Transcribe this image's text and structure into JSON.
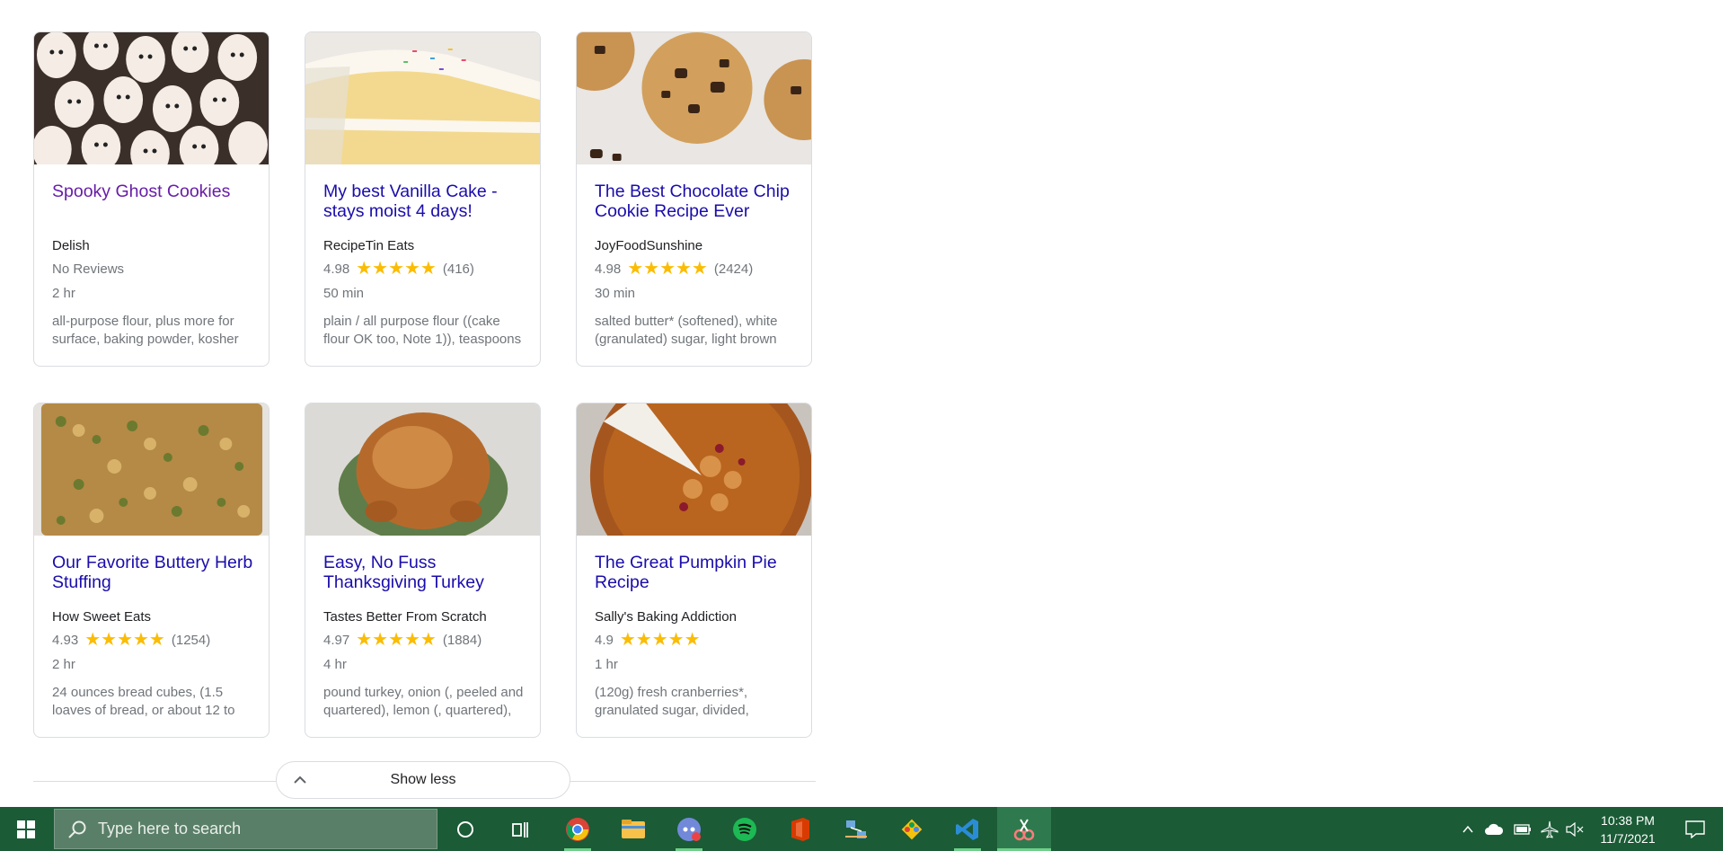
{
  "recipes": [
    {
      "title": "Spooky Ghost Cookies",
      "source": "Delish",
      "rating": "",
      "reviews": "",
      "no_reviews": "No Reviews",
      "time": "2 hr",
      "ingredients": "all-purpose flour, plus more for surface, baking powder, kosher",
      "visited": true,
      "thumb": "ghost-cookies"
    },
    {
      "title": "My best Vanilla Cake - stays moist 4 days!",
      "source": "RecipeTin Eats",
      "rating": "4.98",
      "reviews": "(416)",
      "no_reviews": "",
      "time": "50 min",
      "ingredients": "plain / all purpose flour ((cake flour OK too, Note 1)), teaspoons",
      "visited": false,
      "thumb": "vanilla-cake"
    },
    {
      "title": "The Best Chocolate Chip Cookie Recipe Ever",
      "source": "JoyFoodSunshine",
      "rating": "4.98",
      "reviews": "(2424)",
      "no_reviews": "",
      "time": "30 min",
      "ingredients": "salted butter* (softened), white (granulated) sugar, light brown",
      "visited": false,
      "thumb": "choc-cookies"
    },
    {
      "title": "Our Favorite Buttery Herb Stuffing",
      "source": "How Sweet Eats",
      "rating": "4.93",
      "reviews": "(1254)",
      "no_reviews": "",
      "time": "2 hr",
      "ingredients": "24 ounces bread cubes, (1.5 loaves of bread, or about 12 to",
      "visited": false,
      "thumb": "stuffing"
    },
    {
      "title": "Easy, No Fuss Thanksgiving Turkey",
      "source": "Tastes Better From Scratch",
      "rating": "4.97",
      "reviews": "(1884)",
      "no_reviews": "",
      "time": "4 hr",
      "ingredients": "pound turkey, onion (, peeled and quartered), lemon (, quartered),",
      "visited": false,
      "thumb": "turkey"
    },
    {
      "title": "The Great Pumpkin Pie Recipe",
      "source": "Sally's Baking Addiction",
      "rating": "4.9",
      "reviews": "",
      "no_reviews": "",
      "time": "1 hr",
      "ingredients": "(120g) fresh cranberries*, granulated sugar, divided,",
      "visited": false,
      "thumb": "pumpkin-pie"
    }
  ],
  "stars": "★★★★★",
  "show_less_label": "Show less",
  "taskbar": {
    "search_placeholder": "Type here to search",
    "time": "10:38 PM",
    "date": "11/7/2021",
    "apps": [
      "chrome-icon",
      "file-explorer-icon",
      "discord-icon",
      "spotify-icon",
      "office-icon",
      "network-app-icon",
      "paint-app-icon",
      "vscode-icon",
      "snip-tool-icon"
    ]
  }
}
